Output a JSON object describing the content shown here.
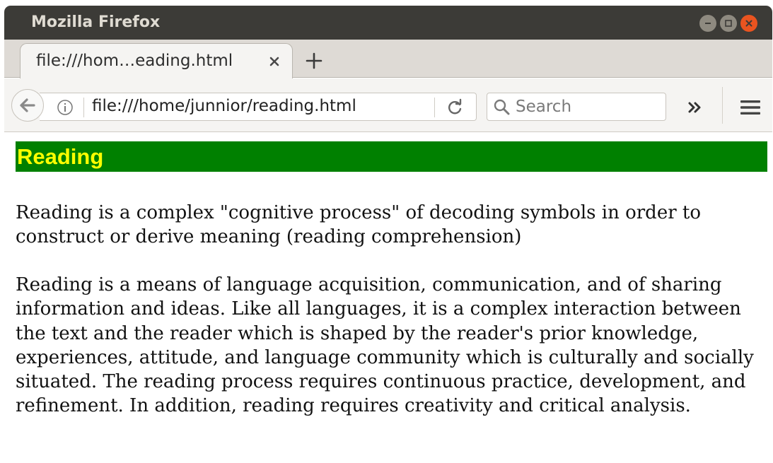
{
  "window": {
    "title": "Mozilla Firefox"
  },
  "tab": {
    "label": "file:///hom…eading.html"
  },
  "navbar": {
    "url": "file:///home/junnior/reading.html",
    "search_placeholder": "Search"
  },
  "page": {
    "heading": "Reading",
    "paragraph1": "Reading is a complex \"cognitive process\" of decoding symbols in order to construct or derive meaning (reading comprehension)",
    "paragraph2": "Reading is a means of language acquisition, communication, and of sharing information and ideas. Like all languages, it is a complex interaction between the text and the reader which is shaped by the reader's prior knowledge, experiences, attitude, and language community which is culturally and socially situated. The reading process requires continuous practice, development, and refinement. In addition, reading requires creativity and critical analysis."
  },
  "colors": {
    "heading_background": "#008000",
    "heading_text": "#ffff00",
    "close_button": "#e95420",
    "titlebar": "#3c3b37"
  },
  "icons": {
    "minimize": "minimize-icon",
    "maximize": "maximize-icon",
    "close": "close-icon",
    "tab_close": "close-icon",
    "new_tab": "plus-icon",
    "back": "back-arrow-icon",
    "info": "info-icon",
    "reload": "reload-icon",
    "search": "search-icon",
    "overflow": "chevron-double-right-icon",
    "menu": "hamburger-menu-icon"
  }
}
